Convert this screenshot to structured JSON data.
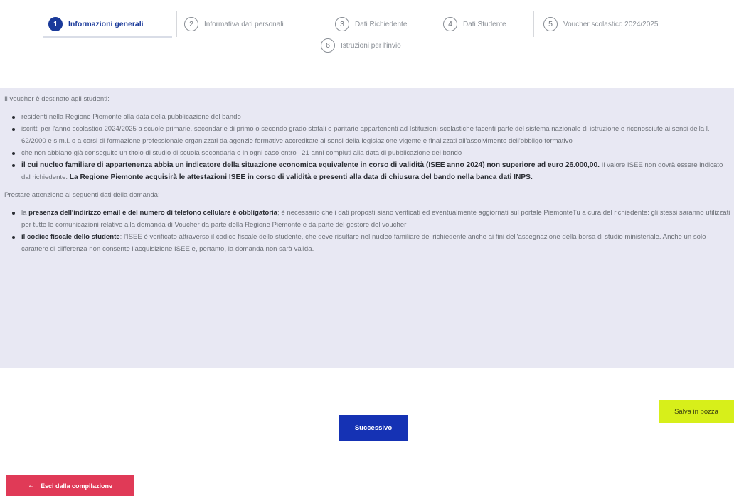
{
  "stepper": {
    "steps": [
      {
        "number": "1",
        "label": "Informazioni generali",
        "active": true
      },
      {
        "number": "2",
        "label": "Informativa dati personali",
        "active": false
      },
      {
        "number": "3",
        "label": "Dati Richiedente",
        "active": false
      },
      {
        "number": "4",
        "label": "Dati Studente",
        "active": false
      },
      {
        "number": "5",
        "label": "Voucher scolastico 2024/2025",
        "active": false
      },
      {
        "number": "6",
        "label": "Istruzioni per l'invio",
        "active": false
      }
    ]
  },
  "info": {
    "intro": "Il voucher è destinato agli studenti:",
    "bullet1": "residenti nella Regione Piemonte alla data della pubblicazione del bando",
    "bullet2": "iscritti per l'anno scolastico 2024/2025 a scuole primarie, secondarie di primo o secondo grado statali o paritarie appartenenti ad Istituzioni scolastiche facenti parte del sistema nazionale di istruzione e riconosciute ai sensi della l. 62/2000 e s.m.i. o a corsi di formazione professionale organizzati da agenzie formative accreditate ai sensi della legislazione vigente e finalizzati all'assolvimento dell'obbligo formativo",
    "bullet3": "che non abbiano già conseguito un titolo di studio di scuola secondaria e in ogni caso entro i 21 anni compiuti alla data di pubblicazione del bando",
    "bullet4_bold1": "il cui nucleo familiare di appartenenza abbia un indicatore della situazione economica equivalente in corso di validità (ISEE anno 2024) non superiore ad euro 26.000,00.",
    "bullet4_normal": " Il valore ISEE non dovrà essere indicato dal richiedente. ",
    "bullet4_bold2": "La Regione Piemonte acquisirà le attestazioni ISEE in corso di validità e presenti alla data di chiusura del bando nella banca dati INPS.",
    "attention": "Prestare attenzione ai seguenti dati della domanda:",
    "bullet5_pre": "la ",
    "bullet5_bold": "presenza dell'indirizzo email e del numero di telefono cellulare è obbligatoria",
    "bullet5_rest": "; è necessario che i dati proposti siano verificati ed eventualmente aggiornati sul portale PiemonteTu a cura del richiedente: gli stessi saranno utilizzati per tutte le comunicazioni relative alla domanda di Voucher da parte della Regione Piemonte e da parte del gestore del voucher",
    "bullet6_bold": "il codice fiscale dello studente",
    "bullet6_rest": ": l'ISEE è verificato attraverso il codice fiscale dello studente, che deve risultare nel nucleo familiare del richiedente anche ai fini dell'assegnazione della borsa di studio ministeriale. Anche un solo carattere di differenza non consente l'acquisizione ISEE e, pertanto, la domanda non sarà valida."
  },
  "actions": {
    "save_draft": "Salva in bozza",
    "next": "Successivo",
    "exit": "Esci dalla compilazione",
    "exit_icon": "arrow-left-icon"
  },
  "colors": {
    "primary": "#1532b4",
    "draft": "#d7ef1a",
    "exit": "#e03a57",
    "panel": "#e8e8f3"
  }
}
